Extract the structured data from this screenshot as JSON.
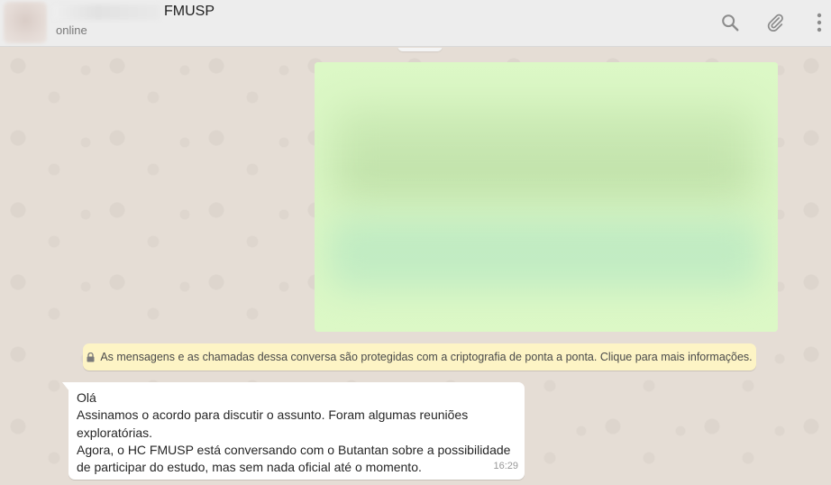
{
  "header": {
    "contact_name": "FMUSP",
    "status": "online",
    "icons": [
      "search-icon",
      "paperclip-icon",
      "menu-dots-icon"
    ]
  },
  "chat": {
    "encryption_notice": "As mensagens e as chamadas dessa conversa são protegidas com a criptografia de ponta a ponta. Clique para mais informações.",
    "incoming_message": {
      "lines": [
        "Olá",
        "Assinamos o acordo para discutir o assunto. Foram algumas reuniões",
        "exploratórias.",
        "Agora, o HC FMUSP está conversando com o Butantan sobre a possibilidade",
        "de participar do estudo, mas sem nada oficial até o momento."
      ],
      "time": "16:29"
    }
  },
  "colors": {
    "header_bg": "#ededed",
    "chat_bg": "#e5ddd5",
    "outgoing_bubble": "#dcf8c6",
    "notice_bg": "#fdf4c5",
    "incoming_bubble": "#ffffff"
  }
}
